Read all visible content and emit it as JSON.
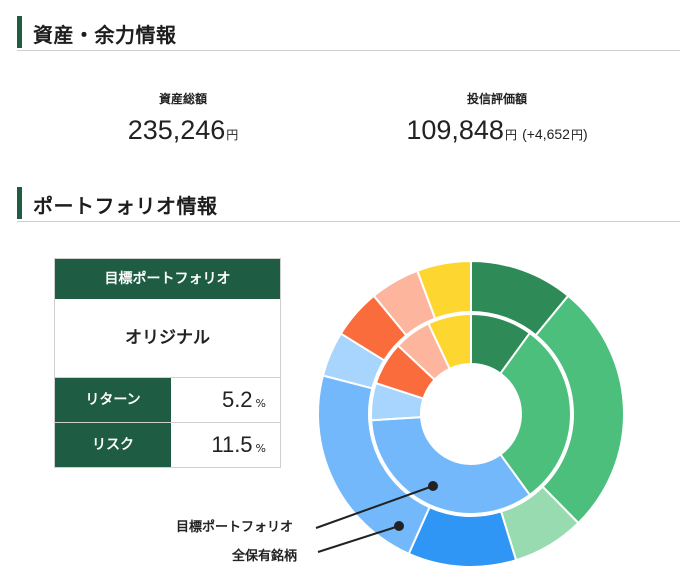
{
  "sections": {
    "assets_title": "資産・余力情報",
    "portfolio_title": "ポートフォリオ情報"
  },
  "assets": {
    "total_label": "資産総額",
    "total_value": "235,246",
    "total_unit": "円",
    "fund_label": "投信評価額",
    "fund_value": "109,848",
    "fund_unit": "円",
    "fund_diff_open": "(",
    "fund_diff_value": "+4,652",
    "fund_diff_unit": "円",
    "fund_diff_close": ")"
  },
  "portfolio": {
    "header": "目標ポートフォリオ",
    "name": "オリジナル",
    "return_label": "リターン",
    "return_value": "5.2",
    "return_unit": "%",
    "risk_label": "リスク",
    "risk_value": "11.5",
    "risk_unit": "%"
  },
  "chart_labels": {
    "inner": "目標ポートフォリオ",
    "outer": "全保有銘柄"
  },
  "chart_data": {
    "type": "pie",
    "inner_ring_name": "目標ポートフォリオ",
    "outer_ring_name": "全保有銘柄",
    "colors": [
      "#2e8b57",
      "#4cbf7d",
      "#98dbb0",
      "#2f96f5",
      "#72b8fb",
      "#a8d5fd",
      "#fa6c3c",
      "#fdb59e",
      "#fed630"
    ],
    "inner_values": [
      0.1,
      0.3,
      0.0,
      0.0,
      0.34,
      0.06,
      0.07,
      0.06,
      0.07
    ],
    "outer_values": [
      0.115,
      0.28,
      0.08,
      0.12,
      0.235,
      0.05,
      0.055,
      0.055,
      0.06
    ]
  }
}
